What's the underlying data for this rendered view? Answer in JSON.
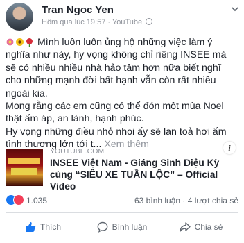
{
  "post": {
    "author": "Tran Ngoc Yen",
    "time": "Hôm qua lúc 19:57",
    "source": "YouTube",
    "text_line_1": "Mình luôn luôn ủng hộ những việc làm ý nghĩa như này, hy vọng không chỉ riêng INSEE mà sẽ có nhiều nhiều nhà hảo tâm hơn nữa biết nghĩ cho những mạnh đời bất hạnh vẫn còn rất nhiều ngoài kia.",
    "text_line_2": "Mong rằng các em cũng có thể đón một mùa Noel thật ấm áp, an lành, hạnh phúc.",
    "text_line_3": "Hy vọng những điều nhỏ nhoi ấy sẽ lan toả hơi ấm tình thương lớn tới t...",
    "see_more": "Xem thêm"
  },
  "link_card": {
    "domain": "YOUTUBE.COM",
    "title": "INSEE Việt Nam - Giáng Sinh Diệu Kỳ cùng “SIÊU XE TUẦN LỘC” – Official Video"
  },
  "stats": {
    "reactions": "1.035",
    "comments_shares": "63 bình luận · 4 lượt chia sẻ"
  },
  "actions": {
    "like": "Thích",
    "comment": "Bình luận",
    "share": "Chia sẻ"
  },
  "colors": {
    "like_blue": "#1877f2",
    "love_red": "#f33e58",
    "secondary_text": "#90949c"
  },
  "icons": [
    "globe-icon",
    "chevron-down-icon",
    "info-icon",
    "like-reaction-icon",
    "love-reaction-icon",
    "thumbs-up-icon",
    "comment-icon",
    "share-icon"
  ]
}
